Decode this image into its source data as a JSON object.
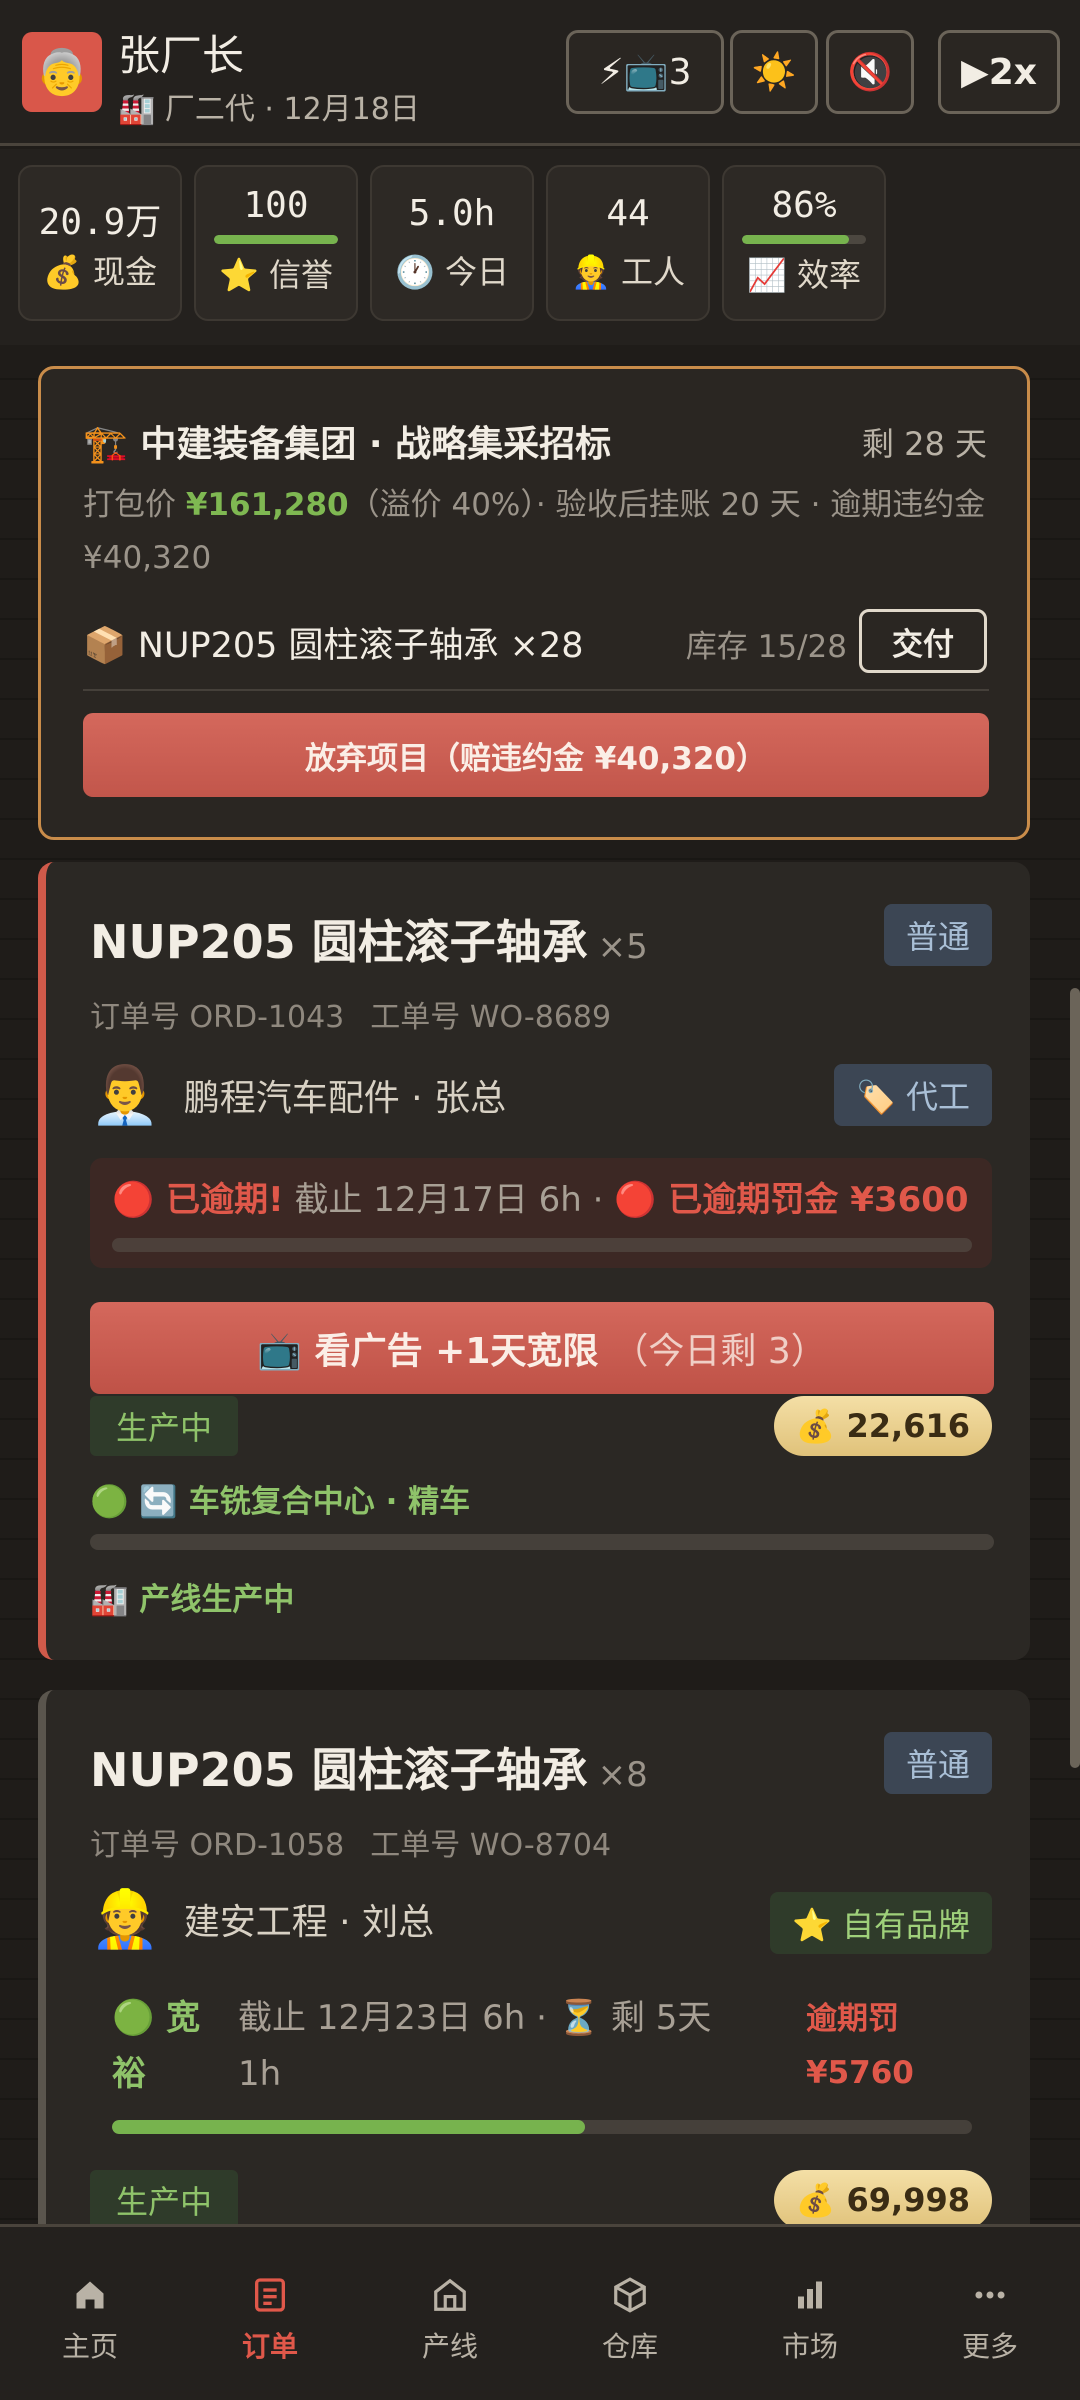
{
  "header": {
    "avatar_emoji": "👵",
    "name": "张厂长",
    "sub": "🏭 厂二代 · 12月18日",
    "ad_button": "⚡📺3",
    "theme_icon": "☀️",
    "mute_icon": "🔇",
    "speed_button": "▶2x"
  },
  "stats": [
    {
      "value": "20.9万",
      "label": "💰 现金"
    },
    {
      "value": "100",
      "label": "⭐ 信誉",
      "bar": 100
    },
    {
      "value": "5.0h",
      "label": "🕐 今日"
    },
    {
      "value": "44",
      "label": "👷 工人"
    },
    {
      "value": "86%",
      "label": "📈 效率",
      "bar": 86
    }
  ],
  "tender": {
    "title": "🏗️ 中建装备集团 · 战略集采招标",
    "remain": "剩 28 天",
    "desc_prefix": "打包价 ",
    "price": "¥161,280",
    "desc_suffix": "（溢价 40%）· 验收后挂账 20 天 · 逾期违约金 ¥40,320",
    "item": "📦 NUP205 圆柱滚子轴承 ×28",
    "stock": "库存 15/28",
    "deliver": "交付",
    "abandon": "放弃项目（赔违约金 ¥40,320）"
  },
  "orders": [
    {
      "title": "NUP205 圆柱滚子轴承",
      "qty": "×5",
      "priority": "普通",
      "order_no": "订单号 ORD-1043",
      "work_no": "工单号 WO-8689",
      "client_face": "👨‍💼",
      "client": "鹏程汽车配件 · 张总",
      "tag": "🏷️ 代工",
      "status": "🔴 已逾期!",
      "deadline": " 截止 12月17日 6h · ",
      "penalty": "🔴 已逾期罚金 ¥3600",
      "deadline_progress": 0,
      "ad_main": "📺 看广告 +1天宽限",
      "ad_sub": "（今日剩 3）",
      "prod_state": "生产中",
      "amount": "💰 22,616",
      "line": "🟢 🔄 车铣复合中心 · 精车",
      "line_progress": 0,
      "line_note": "🏭 产线生产中"
    },
    {
      "title": "NUP205 圆柱滚子轴承",
      "qty": "×8",
      "priority": "普通",
      "order_no": "订单号 ORD-1058",
      "work_no": "工单号 WO-8704",
      "client_face": "👷",
      "client": "建安工程 · 刘总",
      "tag": "⭐ 自有品牌",
      "status_line1": "🟢 宽",
      "status_line2": "裕",
      "deadline_line1": "截止 12月23日 6h · ⏳ 剩 5天",
      "deadline_line2": "1h",
      "penalty_line1": "逾期罚",
      "penalty_line2": "¥5760",
      "deadline_progress": 55,
      "prod_state": "生产中",
      "amount": "💰 69,998"
    }
  ],
  "nav": [
    {
      "icon": "home-icon",
      "label": "主页"
    },
    {
      "icon": "orders-icon",
      "label": "订单",
      "active": true
    },
    {
      "icon": "factory-icon",
      "label": "产线"
    },
    {
      "icon": "box-icon",
      "label": "仓库"
    },
    {
      "icon": "chart-icon",
      "label": "市场"
    },
    {
      "icon": "more-icon",
      "label": "更多"
    }
  ],
  "colors": {
    "accent": "#e0584a",
    "green": "#77b34e",
    "gold": "#c98c4a"
  }
}
